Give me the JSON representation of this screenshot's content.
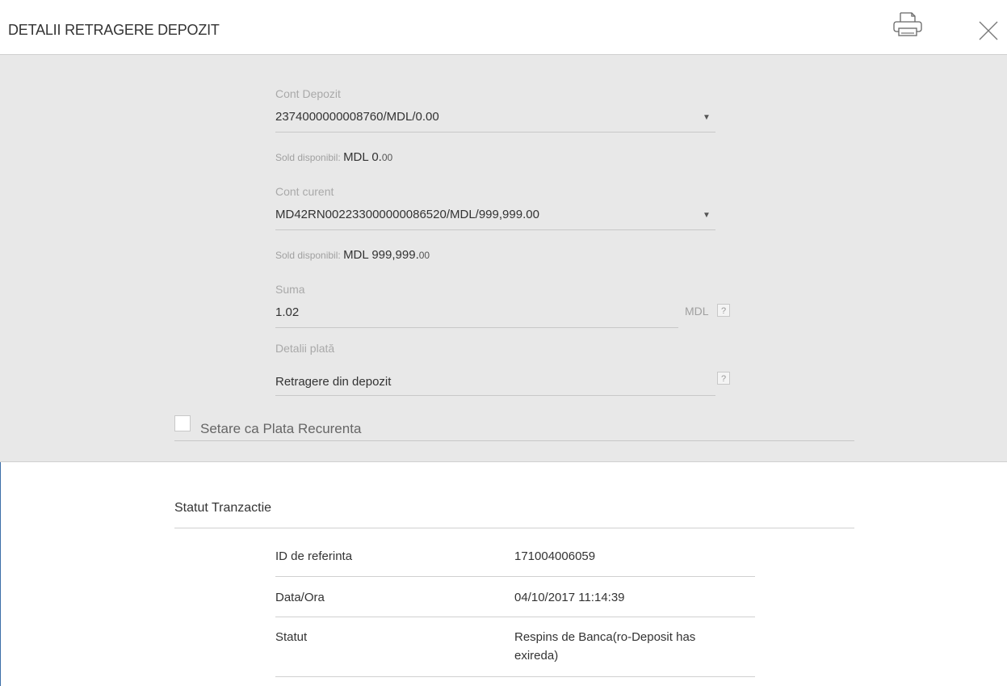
{
  "dialog": {
    "title": "DETALII RETRAGERE DEPOZIT",
    "print_icon": "printer-icon",
    "close_icon": "close-icon"
  },
  "form": {
    "deposit_account": {
      "label": "Cont Depozit",
      "value": "2374000000008760/MDL/0.00",
      "balance_prefix": "Sold disponibil: ",
      "balance_main": "MDL 0.",
      "balance_decimals": "00"
    },
    "current_account": {
      "label": "Cont curent",
      "value": "MD42RN002233000000086520/MDL/999,999.00",
      "balance_prefix": "Sold disponibil: ",
      "balance_main": "MDL 999,999.",
      "balance_decimals": "00"
    },
    "amount": {
      "label": "Suma",
      "value": "1.02",
      "currency": "MDL",
      "help": "?"
    },
    "payment_details": {
      "label": "Detalii plată",
      "value": "Retragere din depozit",
      "help": "?"
    },
    "recurring": {
      "label": "Setare ca Plata Recurenta",
      "checked": false
    }
  },
  "status": {
    "title": "Statut Tranzactie",
    "rows": [
      {
        "label": "ID de referinta",
        "value": "171004006059"
      },
      {
        "label": "Data/Ora",
        "value": "04/10/2017 11:14:39"
      },
      {
        "label": "Statut",
        "value_line1": "Respins de Banca(ro-Deposit has",
        "value_line2": "exireda)"
      }
    ]
  }
}
